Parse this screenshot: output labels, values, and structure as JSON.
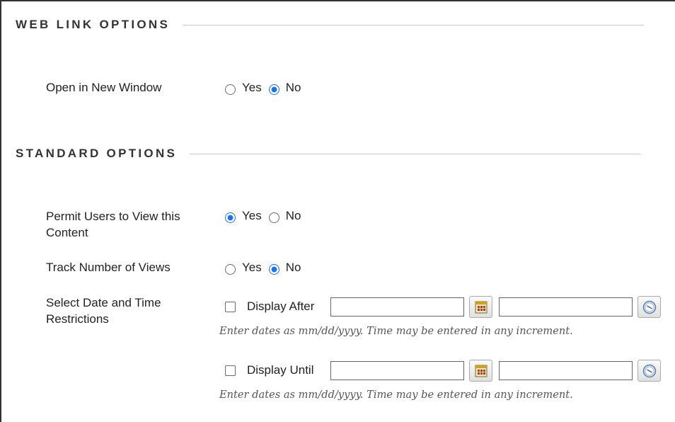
{
  "web_link_options": {
    "title": "WEB LINK OPTIONS",
    "open_new_window": {
      "label": "Open in New Window",
      "options": [
        "Yes",
        "No"
      ],
      "selected": "No"
    }
  },
  "standard_options": {
    "title": "STANDARD OPTIONS",
    "permit_view": {
      "label_line1": "Permit Users to View this",
      "label_line2": "Content",
      "options": [
        "Yes",
        "No"
      ],
      "selected": "Yes"
    },
    "track_views": {
      "label": "Track Number of Views",
      "options": [
        "Yes",
        "No"
      ],
      "selected": "No"
    },
    "date_restrictions": {
      "label_line1": "Select Date and Time",
      "label_line2": "Restrictions",
      "display_after": {
        "label": "Display After",
        "checked": false,
        "date_value": "",
        "time_value": "",
        "hint": "Enter dates as mm/dd/yyyy. Time may be entered in any increment."
      },
      "display_until": {
        "label": "Display Until",
        "checked": false,
        "date_value": "",
        "time_value": "",
        "hint": "Enter dates as mm/dd/yyyy. Time may be entered in any increment."
      }
    }
  },
  "colors": {
    "accent": "#1a73e8",
    "rule": "#c8c8c8",
    "heading": "#333333",
    "hint": "#555555"
  },
  "icons": {
    "calendar": "calendar-icon",
    "clock": "clock-icon"
  }
}
